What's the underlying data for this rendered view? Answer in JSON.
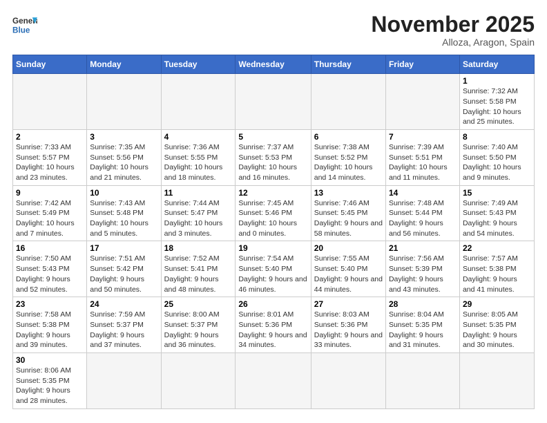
{
  "header": {
    "logo_general": "General",
    "logo_blue": "Blue",
    "title": "November 2025",
    "subtitle": "Alloza, Aragon, Spain"
  },
  "days_of_week": [
    "Sunday",
    "Monday",
    "Tuesday",
    "Wednesday",
    "Thursday",
    "Friday",
    "Saturday"
  ],
  "weeks": [
    [
      {
        "day": "",
        "info": ""
      },
      {
        "day": "",
        "info": ""
      },
      {
        "day": "",
        "info": ""
      },
      {
        "day": "",
        "info": ""
      },
      {
        "day": "",
        "info": ""
      },
      {
        "day": "",
        "info": ""
      },
      {
        "day": "1",
        "info": "Sunrise: 7:32 AM\nSunset: 5:58 PM\nDaylight: 10 hours and 25 minutes."
      }
    ],
    [
      {
        "day": "2",
        "info": "Sunrise: 7:33 AM\nSunset: 5:57 PM\nDaylight: 10 hours and 23 minutes."
      },
      {
        "day": "3",
        "info": "Sunrise: 7:35 AM\nSunset: 5:56 PM\nDaylight: 10 hours and 21 minutes."
      },
      {
        "day": "4",
        "info": "Sunrise: 7:36 AM\nSunset: 5:55 PM\nDaylight: 10 hours and 18 minutes."
      },
      {
        "day": "5",
        "info": "Sunrise: 7:37 AM\nSunset: 5:53 PM\nDaylight: 10 hours and 16 minutes."
      },
      {
        "day": "6",
        "info": "Sunrise: 7:38 AM\nSunset: 5:52 PM\nDaylight: 10 hours and 14 minutes."
      },
      {
        "day": "7",
        "info": "Sunrise: 7:39 AM\nSunset: 5:51 PM\nDaylight: 10 hours and 11 minutes."
      },
      {
        "day": "8",
        "info": "Sunrise: 7:40 AM\nSunset: 5:50 PM\nDaylight: 10 hours and 9 minutes."
      }
    ],
    [
      {
        "day": "9",
        "info": "Sunrise: 7:42 AM\nSunset: 5:49 PM\nDaylight: 10 hours and 7 minutes."
      },
      {
        "day": "10",
        "info": "Sunrise: 7:43 AM\nSunset: 5:48 PM\nDaylight: 10 hours and 5 minutes."
      },
      {
        "day": "11",
        "info": "Sunrise: 7:44 AM\nSunset: 5:47 PM\nDaylight: 10 hours and 3 minutes."
      },
      {
        "day": "12",
        "info": "Sunrise: 7:45 AM\nSunset: 5:46 PM\nDaylight: 10 hours and 0 minutes."
      },
      {
        "day": "13",
        "info": "Sunrise: 7:46 AM\nSunset: 5:45 PM\nDaylight: 9 hours and 58 minutes."
      },
      {
        "day": "14",
        "info": "Sunrise: 7:48 AM\nSunset: 5:44 PM\nDaylight: 9 hours and 56 minutes."
      },
      {
        "day": "15",
        "info": "Sunrise: 7:49 AM\nSunset: 5:43 PM\nDaylight: 9 hours and 54 minutes."
      }
    ],
    [
      {
        "day": "16",
        "info": "Sunrise: 7:50 AM\nSunset: 5:43 PM\nDaylight: 9 hours and 52 minutes."
      },
      {
        "day": "17",
        "info": "Sunrise: 7:51 AM\nSunset: 5:42 PM\nDaylight: 9 hours and 50 minutes."
      },
      {
        "day": "18",
        "info": "Sunrise: 7:52 AM\nSunset: 5:41 PM\nDaylight: 9 hours and 48 minutes."
      },
      {
        "day": "19",
        "info": "Sunrise: 7:54 AM\nSunset: 5:40 PM\nDaylight: 9 hours and 46 minutes."
      },
      {
        "day": "20",
        "info": "Sunrise: 7:55 AM\nSunset: 5:40 PM\nDaylight: 9 hours and 44 minutes."
      },
      {
        "day": "21",
        "info": "Sunrise: 7:56 AM\nSunset: 5:39 PM\nDaylight: 9 hours and 43 minutes."
      },
      {
        "day": "22",
        "info": "Sunrise: 7:57 AM\nSunset: 5:38 PM\nDaylight: 9 hours and 41 minutes."
      }
    ],
    [
      {
        "day": "23",
        "info": "Sunrise: 7:58 AM\nSunset: 5:38 PM\nDaylight: 9 hours and 39 minutes."
      },
      {
        "day": "24",
        "info": "Sunrise: 7:59 AM\nSunset: 5:37 PM\nDaylight: 9 hours and 37 minutes."
      },
      {
        "day": "25",
        "info": "Sunrise: 8:00 AM\nSunset: 5:37 PM\nDaylight: 9 hours and 36 minutes."
      },
      {
        "day": "26",
        "info": "Sunrise: 8:01 AM\nSunset: 5:36 PM\nDaylight: 9 hours and 34 minutes."
      },
      {
        "day": "27",
        "info": "Sunrise: 8:03 AM\nSunset: 5:36 PM\nDaylight: 9 hours and 33 minutes."
      },
      {
        "day": "28",
        "info": "Sunrise: 8:04 AM\nSunset: 5:35 PM\nDaylight: 9 hours and 31 minutes."
      },
      {
        "day": "29",
        "info": "Sunrise: 8:05 AM\nSunset: 5:35 PM\nDaylight: 9 hours and 30 minutes."
      }
    ],
    [
      {
        "day": "30",
        "info": "Sunrise: 8:06 AM\nSunset: 5:35 PM\nDaylight: 9 hours and 28 minutes."
      },
      {
        "day": "",
        "info": ""
      },
      {
        "day": "",
        "info": ""
      },
      {
        "day": "",
        "info": ""
      },
      {
        "day": "",
        "info": ""
      },
      {
        "day": "",
        "info": ""
      },
      {
        "day": "",
        "info": ""
      }
    ]
  ]
}
